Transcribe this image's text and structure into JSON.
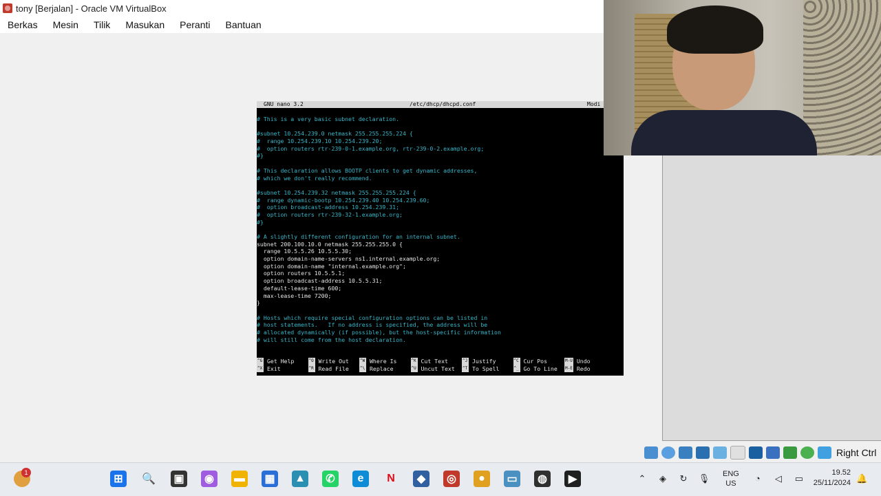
{
  "window": {
    "title": "tony [Berjalan] - Oracle VM VirtualBox"
  },
  "menu": [
    "Berkas",
    "Mesin",
    "Tilik",
    "Masukan",
    "Peranti",
    "Bantuan"
  ],
  "nano": {
    "header_left": "GNU nano 3.2",
    "header_file": "/etc/dhcp/dhcpd.conf",
    "header_right": "Modi",
    "lines": [
      {
        "t": "# This is a very basic subnet declaration.",
        "c": "comment"
      },
      {
        "t": "",
        "c": "plain"
      },
      {
        "t": "#subnet 10.254.239.0 netmask 255.255.255.224 {",
        "c": "comment"
      },
      {
        "t": "#  range 10.254.239.10 10.254.239.20;",
        "c": "comment"
      },
      {
        "t": "#  option routers rtr-239-0-1.example.org, rtr-239-0-2.example.org;",
        "c": "comment"
      },
      {
        "t": "#}",
        "c": "comment"
      },
      {
        "t": "",
        "c": "plain"
      },
      {
        "t": "# This declaration allows BOOTP clients to get dynamic addresses,",
        "c": "comment"
      },
      {
        "t": "# which we don't really recommend.",
        "c": "comment"
      },
      {
        "t": "",
        "c": "plain"
      },
      {
        "t": "#subnet 10.254.239.32 netmask 255.255.255.224 {",
        "c": "comment"
      },
      {
        "t": "#  range dynamic-bootp 10.254.239.40 10.254.239.60;",
        "c": "comment"
      },
      {
        "t": "#  option broadcast-address 10.254.239.31;",
        "c": "comment"
      },
      {
        "t": "#  option routers rtr-239-32-1.example.org;",
        "c": "comment"
      },
      {
        "t": "#}",
        "c": "comment"
      },
      {
        "t": "",
        "c": "plain"
      },
      {
        "t": "# A slightly different configuration for an internal subnet.",
        "c": "comment"
      },
      {
        "t": "subnet 200.100.10.0 netmask 255.255.255.0 {",
        "c": "plain"
      },
      {
        "t": "  range 10.5.5.26 10.5.5.30;",
        "c": "plain"
      },
      {
        "t": "  option domain-name-servers ns1.internal.example.org;",
        "c": "plain"
      },
      {
        "t": "  option domain-name \"internal.example.org\";",
        "c": "plain"
      },
      {
        "t": "  option routers 10.5.5.1;",
        "c": "plain"
      },
      {
        "t": "  option broadcast-address 10.5.5.31;",
        "c": "plain"
      },
      {
        "t": "  default-lease-time 600;",
        "c": "plain"
      },
      {
        "t": "  max-lease-time 7200;",
        "c": "plain"
      },
      {
        "t": "}",
        "c": "plain"
      },
      {
        "t": "",
        "c": "plain"
      },
      {
        "t": "# Hosts which require special configuration options can be listed in",
        "c": "comment"
      },
      {
        "t": "# host statements.   If no address is specified, the address will be",
        "c": "comment"
      },
      {
        "t": "# allocated dynamically (if possible), but the host-specific information",
        "c": "comment"
      },
      {
        "t": "# will still come from the host declaration.",
        "c": "comment"
      }
    ],
    "shortcuts_row1": [
      {
        "k": "^G",
        "l": "Get Help"
      },
      {
        "k": "^O",
        "l": "Write Out"
      },
      {
        "k": "^W",
        "l": "Where Is"
      },
      {
        "k": "^K",
        "l": "Cut Text"
      },
      {
        "k": "^J",
        "l": "Justify"
      },
      {
        "k": "^C",
        "l": "Cur Pos"
      },
      {
        "k": "M-U",
        "l": "Undo"
      }
    ],
    "shortcuts_row2": [
      {
        "k": "^X",
        "l": "Exit"
      },
      {
        "k": "^R",
        "l": "Read File"
      },
      {
        "k": "^\\",
        "l": "Replace"
      },
      {
        "k": "^U",
        "l": "Uncut Text"
      },
      {
        "k": "^T",
        "l": "To Spell"
      },
      {
        "k": "^_",
        "l": "Go To Line"
      },
      {
        "k": "M-E",
        "l": "Redo"
      }
    ]
  },
  "vbox_status": {
    "host_key": "Right Ctrl"
  },
  "taskbar": {
    "widget_badge": "1",
    "apps": [
      {
        "name": "start-icon",
        "color": "#1a73e8",
        "glyph": "⊞"
      },
      {
        "name": "search-icon",
        "color": "#e8ecf1",
        "glyph": "🔍"
      },
      {
        "name": "task-view-icon",
        "color": "#333333",
        "glyph": "▣"
      },
      {
        "name": "copilot-icon",
        "color": "#a05ce0",
        "glyph": "◉"
      },
      {
        "name": "file-explorer-icon",
        "color": "#f0b400",
        "glyph": "▬"
      },
      {
        "name": "store-icon",
        "color": "#2a6fd6",
        "glyph": "▦"
      },
      {
        "name": "photos-icon",
        "color": "#2a8fb0",
        "glyph": "▲"
      },
      {
        "name": "whatsapp-icon",
        "color": "#25d366",
        "glyph": "✆"
      },
      {
        "name": "edge-icon",
        "color": "#0f8cd6",
        "glyph": "e"
      },
      {
        "name": "netflix-icon",
        "color": "#e8ecf1",
        "glyph": "N"
      },
      {
        "name": "virtualbox-icon",
        "color": "#3060a0",
        "glyph": "◆"
      },
      {
        "name": "debian-vm-icon",
        "color": "#c0392b",
        "glyph": "◎"
      },
      {
        "name": "chrome-icon",
        "color": "#e0a020",
        "glyph": "●"
      },
      {
        "name": "remote-desktop-icon",
        "color": "#4a90c0",
        "glyph": "▭"
      },
      {
        "name": "davinci-icon",
        "color": "#303030",
        "glyph": "◍"
      },
      {
        "name": "media-player-icon",
        "color": "#202020",
        "glyph": "▶"
      }
    ],
    "lang_1": "ENG",
    "lang_2": "US",
    "time": "19.52",
    "date": "25/11/2024"
  }
}
